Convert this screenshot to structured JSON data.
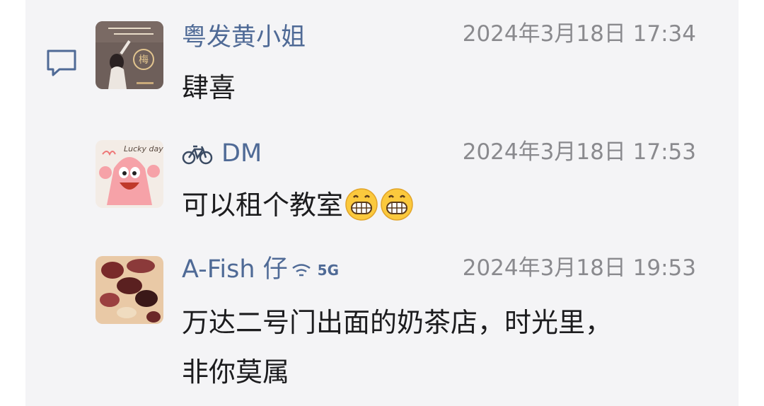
{
  "comments": [
    {
      "name": "粤发黄小姐",
      "time": "2024年3月18日 17:34",
      "message": "肆喜",
      "avatar_icon": "girl-photo-avatar"
    },
    {
      "name": "DM",
      "name_prefix_icon": "bicycle-icon",
      "time": "2024年3月18日 17:53",
      "message": "可以租个教室",
      "emoji_count": 2,
      "avatar_icon": "patrick-star-avatar",
      "avatar_text": "Lucky day"
    },
    {
      "name": "A-Fish 仔",
      "status": "5G",
      "time": "2024年3月18日 19:53",
      "message_line1": "万达二号门出面的奶茶店，时光里，",
      "message_line2": "非你莫属",
      "avatar_icon": "food-photo-avatar"
    }
  ],
  "colors": {
    "name": "#4f6a96",
    "time": "#8a8a8e",
    "text": "#1c1c1e",
    "panel": "#f4f4f6"
  }
}
